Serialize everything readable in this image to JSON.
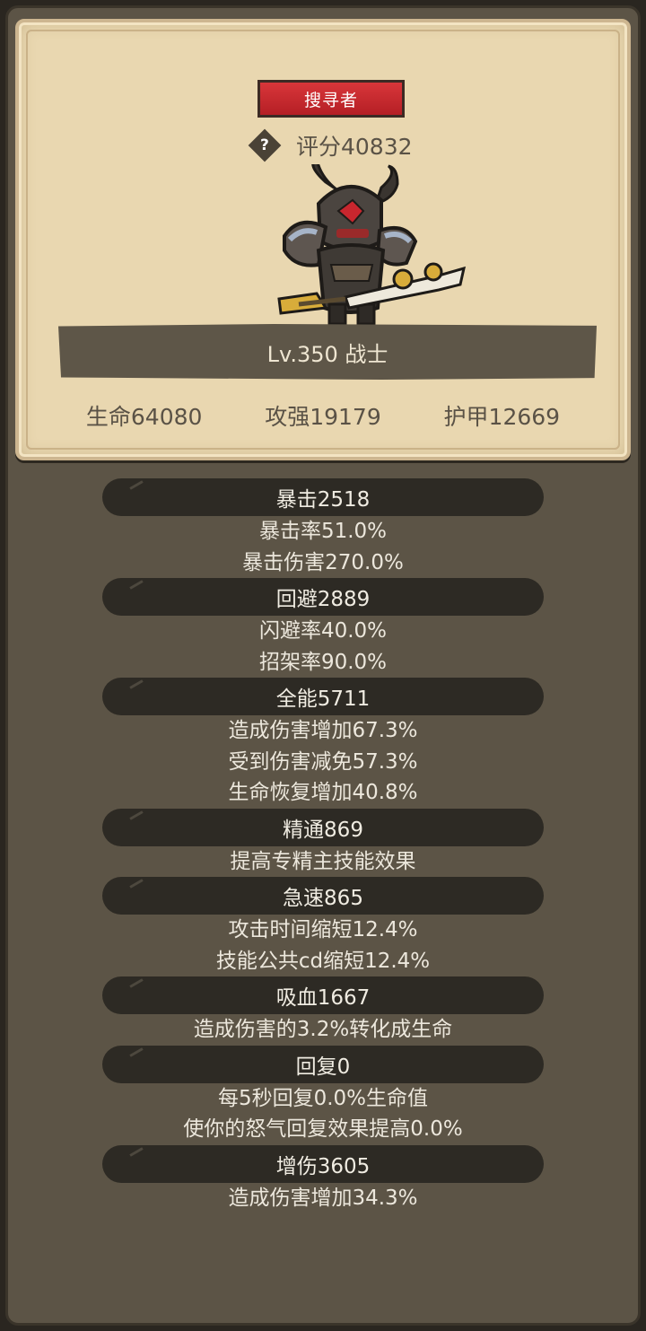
{
  "card": {
    "rank": "搜寻者",
    "score": "评分40832",
    "help_glyph": "?",
    "level": "Lv.350 战士",
    "stats": [
      "生命64080",
      "攻强19179",
      "护甲12669"
    ]
  },
  "details": [
    {
      "head": "暴击2518",
      "lines": [
        "暴击率51.0%",
        "暴击伤害270.0%"
      ]
    },
    {
      "head": "回避2889",
      "lines": [
        "闪避率40.0%",
        "招架率90.0%"
      ]
    },
    {
      "head": "全能5711",
      "lines": [
        "造成伤害增加67.3%",
        "受到伤害减免57.3%",
        "生命恢复增加40.8%"
      ]
    },
    {
      "head": "精通869",
      "lines": [
        "提高专精主技能效果"
      ]
    },
    {
      "head": "急速865",
      "lines": [
        "攻击时间缩短12.4%",
        "技能公共cd缩短12.4%"
      ]
    },
    {
      "head": "吸血1667",
      "lines": [
        "造成伤害的3.2%转化成生命"
      ]
    },
    {
      "head": "回复0",
      "lines": [
        "每5秒回复0.0%生命值",
        "使你的怒气回复效果提高0.0%"
      ]
    },
    {
      "head": "增伤3605",
      "lines": [
        "造成伤害增加34.3%"
      ]
    }
  ],
  "colors": {
    "panel": "#5c5446",
    "parchment": "#e9d7b0",
    "badge": "#c42a2f",
    "pill": "#2d2a24"
  },
  "icons": [
    "help-icon",
    "warrior-avatar"
  ]
}
